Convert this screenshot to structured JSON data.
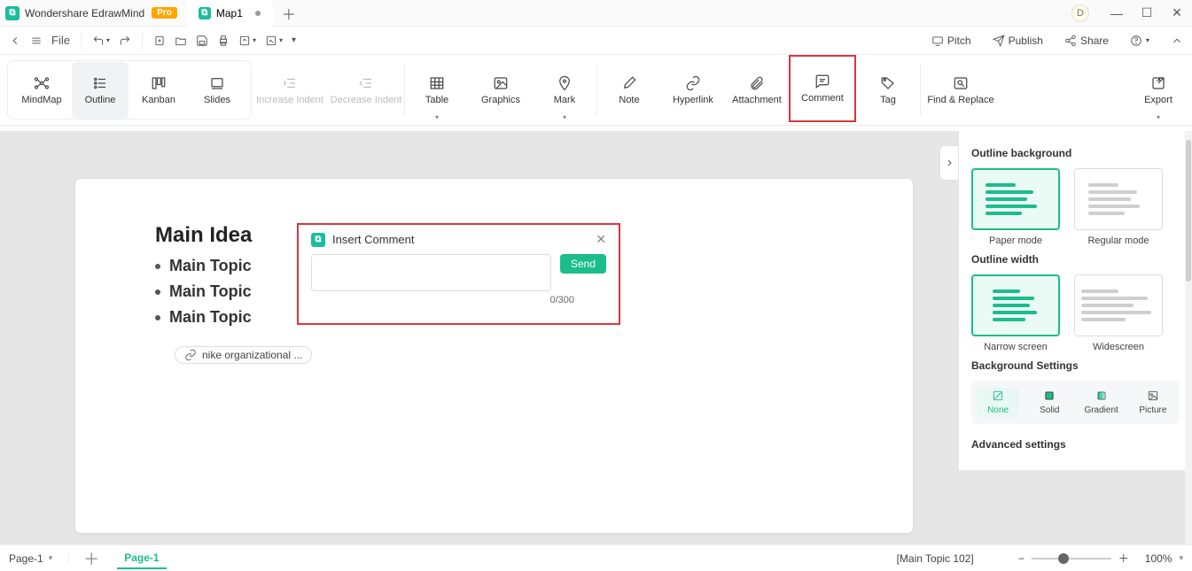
{
  "titlebar": {
    "app_name": "Wondershare EdrawMind",
    "pro_badge": "Pro",
    "tab_label": "Map1",
    "user_initial": "D"
  },
  "menubar": {
    "file": "File",
    "right": {
      "pitch": "Pitch",
      "publish": "Publish",
      "share": "Share"
    }
  },
  "ribbon": {
    "views": {
      "mindmap": "MindMap",
      "outline": "Outline",
      "kanban": "Kanban",
      "slides": "Slides"
    },
    "increase_indent": "Increase Indent",
    "decrease_indent": "Decrease Indent",
    "table": "Table",
    "graphics": "Graphics",
    "mark": "Mark",
    "note": "Note",
    "hyperlink": "Hyperlink",
    "attachment": "Attachment",
    "comment": "Comment",
    "tag": "Tag",
    "find_replace": "Find & Replace",
    "export": "Export"
  },
  "outline": {
    "main_idea": "Main Idea",
    "topics": [
      "Main Topic",
      "Main Topic",
      "Main Topic"
    ],
    "attachment_text": "nike organizational ..."
  },
  "comment_popup": {
    "title": "Insert Comment",
    "send": "Send",
    "counter": "0/300",
    "placeholder": ""
  },
  "rightpanel": {
    "outline_bg_title": "Outline background",
    "paper_mode": "Paper mode",
    "regular_mode": "Regular mode",
    "outline_width_title": "Outline width",
    "narrow": "Narrow screen",
    "wide": "Widescreen",
    "bg_settings_title": "Background Settings",
    "bg_opts": {
      "none": "None",
      "solid": "Solid",
      "gradient": "Gradient",
      "picture": "Picture"
    },
    "advanced": "Advanced settings"
  },
  "statusbar": {
    "page_dd": "Page-1",
    "page_current": "Page-1",
    "status_text": "[Main Topic 102]",
    "zoom_pct": "100%"
  }
}
